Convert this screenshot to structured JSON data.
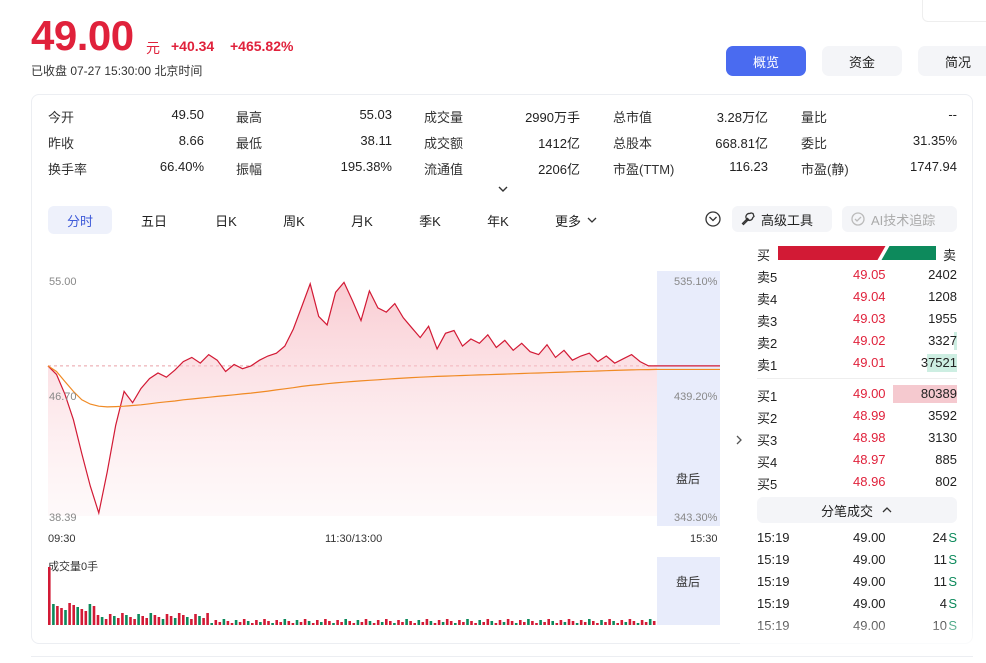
{
  "header": {
    "price": "49.00",
    "unit": "元",
    "change": "+40.34",
    "change_pct": "+465.82%",
    "status": "已收盘  07-27 15:30:00  北京时间"
  },
  "top_tabs": [
    "概览",
    "资金",
    "简况"
  ],
  "stats": [
    [
      {
        "label": "今开",
        "value": "49.50",
        "color": "red"
      },
      {
        "label": "最高",
        "value": "55.03",
        "color": "red"
      },
      {
        "label": "成交量",
        "value": "2990万手"
      },
      {
        "label": "总市值",
        "value": "3.28万亿"
      },
      {
        "label": "量比",
        "value": "--"
      }
    ],
    [
      {
        "label": "昨收",
        "value": "8.66"
      },
      {
        "label": "最低",
        "value": "38.11",
        "color": "red"
      },
      {
        "label": "成交额",
        "value": "1412亿"
      },
      {
        "label": "总股本",
        "value": "668.81亿"
      },
      {
        "label": "委比",
        "value": "31.35%"
      }
    ],
    [
      {
        "label": "换手率",
        "value": "66.40%"
      },
      {
        "label": "振幅",
        "value": "195.38%"
      },
      {
        "label": "流通值",
        "value": "2206亿"
      },
      {
        "label": "市盈(TTM)",
        "value": "116.23"
      },
      {
        "label": "市盈(静)",
        "value": "1747.94"
      }
    ]
  ],
  "period_tabs": [
    "分时",
    "五日",
    "日K",
    "周K",
    "月K",
    "季K",
    "年K",
    "更多"
  ],
  "tools": {
    "advanced": "高级工具",
    "ai": "AI技术追踪"
  },
  "chart": {
    "y_max": "55.00",
    "y_mid": "46.70",
    "y_min": "38.39",
    "pct_top": "535.10%",
    "pct_mid": "439.20%",
    "pct_bottom": "343.30%",
    "x_start": "09:30",
    "x_mid": "11:30/13:00",
    "x_end": "15:30",
    "after_hours": "盘后",
    "volume_label": "成交量0手"
  },
  "chart_data": {
    "type": "line",
    "x_range": [
      "09:30",
      "15:30"
    ],
    "ylim": [
      38.39,
      55.0
    ],
    "reference": 49.0,
    "series": [],
    "price": [
      49.0,
      48.4,
      47.0,
      45.2,
      42.8,
      40.5,
      38.6,
      41.5,
      44.8,
      47.2,
      46.4,
      47.4,
      48.1,
      48.5,
      48.2,
      48.7,
      49.3,
      49.6,
      49.2,
      49.8,
      49.4,
      48.6,
      49.1,
      48.8,
      49.0,
      49.4,
      49.7,
      49.9,
      50.4,
      51.6,
      53.2,
      54.8,
      52.5,
      51.9,
      54.2,
      54.9,
      53.6,
      52.2,
      54.3,
      53.1,
      52.8,
      53.4,
      52.4,
      51.7,
      51.0,
      51.8,
      50.2,
      51.3,
      51.5,
      50.4,
      50.9,
      50.6,
      51.2,
      50.3,
      50.8,
      50.1,
      50.6,
      50.0,
      49.8,
      50.5,
      49.6,
      50.1,
      49.4,
      49.7,
      49.9,
      49.3,
      49.7,
      49.2,
      49.5,
      49.8,
      49.3,
      49.0,
      49.0
    ],
    "average": [
      49.0,
      48.6,
      47.9,
      47.2,
      46.6,
      46.3,
      46.15,
      46.1,
      46.12,
      46.15,
      46.2,
      46.25,
      46.32,
      46.4,
      46.46,
      46.52,
      46.6,
      46.66,
      46.72,
      46.78,
      46.84,
      46.9,
      46.96,
      47.02,
      47.08,
      47.15,
      47.22,
      47.3,
      47.38,
      47.46,
      47.55,
      47.62,
      47.68,
      47.74,
      47.8,
      47.85,
      47.9,
      47.94,
      47.98,
      48.02,
      48.06,
      48.1,
      48.14,
      48.17,
      48.2,
      48.23,
      48.26,
      48.28,
      48.3,
      48.32,
      48.34,
      48.36,
      48.38,
      48.4,
      48.42,
      48.44,
      48.46,
      48.48,
      48.5,
      48.52,
      48.54,
      48.56,
      48.58,
      48.6,
      48.62,
      48.64,
      48.66,
      48.68,
      48.7,
      48.72,
      48.73,
      48.74,
      48.75
    ]
  },
  "orderbook": {
    "buy_label": "买",
    "sell_label": "卖",
    "buy_ratio": 0.655,
    "asks": [
      {
        "label": "卖5",
        "price": "49.05",
        "vol": "2402",
        "bar": 0
      },
      {
        "label": "卖4",
        "price": "49.04",
        "vol": "1208",
        "bar": 0
      },
      {
        "label": "卖3",
        "price": "49.03",
        "vol": "1955",
        "bar": 0
      },
      {
        "label": "卖2",
        "price": "49.02",
        "vol": "3327",
        "bar": 0.04
      },
      {
        "label": "卖1",
        "price": "49.01",
        "vol": "37521",
        "bar": 0.47
      }
    ],
    "bids": [
      {
        "label": "买1",
        "price": "49.00",
        "vol": "80389",
        "bar": 1.0
      },
      {
        "label": "买2",
        "price": "48.99",
        "vol": "3592",
        "bar": 0
      },
      {
        "label": "买3",
        "price": "48.98",
        "vol": "3130",
        "bar": 0
      },
      {
        "label": "买4",
        "price": "48.97",
        "vol": "885",
        "bar": 0
      },
      {
        "label": "买5",
        "price": "48.96",
        "vol": "802",
        "bar": 0
      }
    ]
  },
  "ticks": {
    "header": "分笔成交",
    "rows": [
      {
        "time": "15:19",
        "price": "49.00",
        "vol": "24",
        "side": "S"
      },
      {
        "time": "15:19",
        "price": "49.00",
        "vol": "11",
        "side": "S"
      },
      {
        "time": "15:19",
        "price": "49.00",
        "vol": "11",
        "side": "S"
      },
      {
        "time": "15:19",
        "price": "49.00",
        "vol": "4",
        "side": "S"
      },
      {
        "time": "15:19",
        "price": "49.00",
        "vol": "10",
        "side": "S"
      }
    ]
  },
  "colors": {
    "up": "#e0213b",
    "down": "#0d8a5c",
    "accent": "#4a6bf0",
    "avg_line": "#f08a24"
  }
}
